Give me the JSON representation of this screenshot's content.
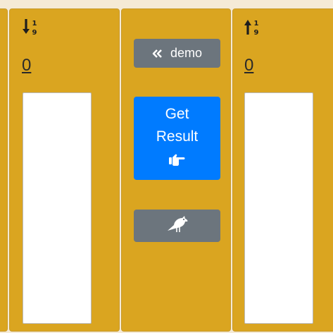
{
  "left_panel": {
    "sort_icon": "sort-numeric-down-icon",
    "count": "0",
    "textarea_value": ""
  },
  "middle_panel": {
    "demo_button": {
      "icon": "angle-double-left-icon",
      "label": "demo"
    },
    "result_button": {
      "label": "Get Result",
      "icon": "hand-point-right-icon"
    },
    "bird_button": {
      "icon": "crow-icon"
    }
  },
  "right_panel": {
    "sort_icon": "sort-numeric-up-icon",
    "count": "0",
    "textarea_value": ""
  },
  "colors": {
    "background": "#f5ead6",
    "panel": "#daa520",
    "secondary_button": "#6c757d",
    "primary_button": "#007bff"
  }
}
